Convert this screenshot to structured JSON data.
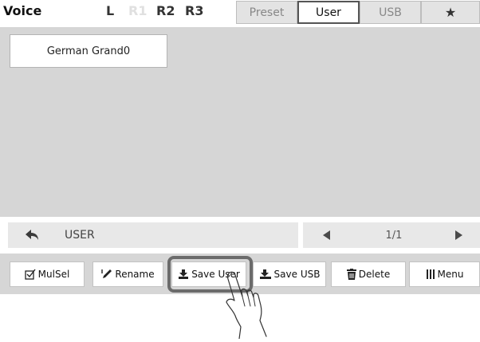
{
  "header": {
    "title": "Voice",
    "parts": {
      "l": "L",
      "r1": "R1",
      "r2": "R2",
      "r3": "R3"
    },
    "tabs": {
      "preset": "Preset",
      "user": "User",
      "usb": "USB",
      "favorite": "★"
    }
  },
  "main": {
    "voices": [
      {
        "name": "German Grand0"
      }
    ]
  },
  "pathbar": {
    "path": "USER",
    "page": "1/1"
  },
  "toolbar": {
    "mulsel": "MulSel",
    "rename": "Rename",
    "save_user": "Save User",
    "save_usb": "Save USB",
    "delete": "Delete",
    "menu": "Menu"
  },
  "colors": {
    "panel_gray": "#d6d6d6",
    "highlight": "#6b6b6b",
    "active_tab_border": "#555555"
  },
  "icons": [
    "back-arrow-icon",
    "prev-arrow-icon",
    "next-arrow-icon",
    "checkbox-icon",
    "pencil-icon",
    "save-user-icon",
    "save-usb-icon",
    "trash-icon",
    "menu-bars-icon",
    "star-icon",
    "pointing-hand-icon"
  ]
}
